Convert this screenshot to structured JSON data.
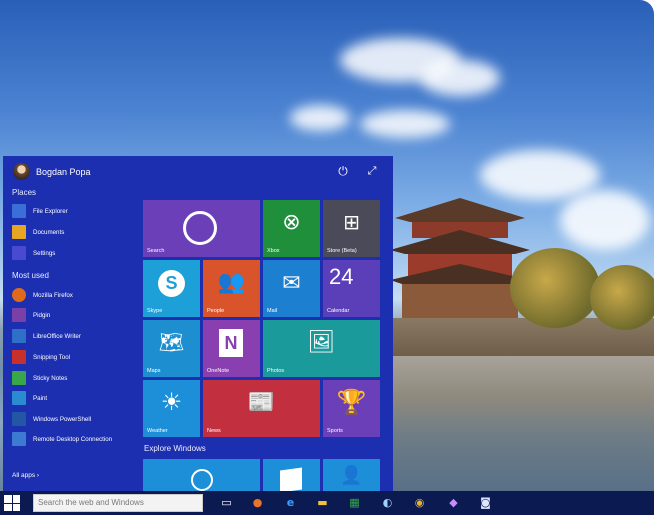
{
  "user": {
    "name": "Bogdan Popa"
  },
  "icons": {
    "power": "power-icon",
    "expand": "expand-icon"
  },
  "places": {
    "heading": "Places",
    "items": [
      {
        "label": "File Explorer",
        "icon": "folder-icon",
        "color": "#3a6fd8"
      },
      {
        "label": "Documents",
        "icon": "documents-icon",
        "color": "#e6a623"
      },
      {
        "label": "Settings",
        "icon": "gear-icon",
        "color": "#4a4ad0"
      }
    ]
  },
  "most_used": {
    "heading": "Most used",
    "items": [
      {
        "label": "Mozilla Firefox",
        "icon": "firefox-icon",
        "color": "#e06a1b"
      },
      {
        "label": "Pidgin",
        "icon": "pidgin-icon",
        "color": "#7b3fa8"
      },
      {
        "label": "LibreOffice Writer",
        "icon": "writer-icon",
        "color": "#2f6fc7"
      },
      {
        "label": "Snipping Tool",
        "icon": "scissors-icon",
        "color": "#c8302c"
      },
      {
        "label": "Sticky Notes",
        "icon": "sticky-notes-icon",
        "color": "#3aa64a"
      },
      {
        "label": "Paint",
        "icon": "paint-icon",
        "color": "#2b8bd0"
      },
      {
        "label": "Windows PowerShell",
        "icon": "powershell-icon",
        "color": "#2456a6"
      },
      {
        "label": "Remote Desktop Connection",
        "icon": "remote-desktop-icon",
        "color": "#3d7bd2"
      }
    ]
  },
  "all_apps": "All apps  ›",
  "tiles": {
    "search": "Search",
    "xbox": "Xbox",
    "store": "Store (Beta)",
    "skype": "Skype",
    "people": "People",
    "mail": "Mail",
    "calendar": "Calendar",
    "calendar_day": "24",
    "maps": "Maps",
    "onenote": "OneNote",
    "photos": "Photos",
    "weather": "Weather",
    "news": "News",
    "sports": "Sports"
  },
  "explore_heading": "Explore Windows",
  "taskbar": {
    "search_placeholder": "Search the web and Windows"
  },
  "colors": {
    "start_bg": "#1c2fb0",
    "tile_purple": "#6a3fb8",
    "tile_green": "#1f8f3c",
    "tile_blue": "#1d9fd8",
    "tile_orange": "#d9542a",
    "tile_teal": "#1a9a9a",
    "tile_red": "#c23040",
    "taskbar_bg": "#0c1a52"
  }
}
